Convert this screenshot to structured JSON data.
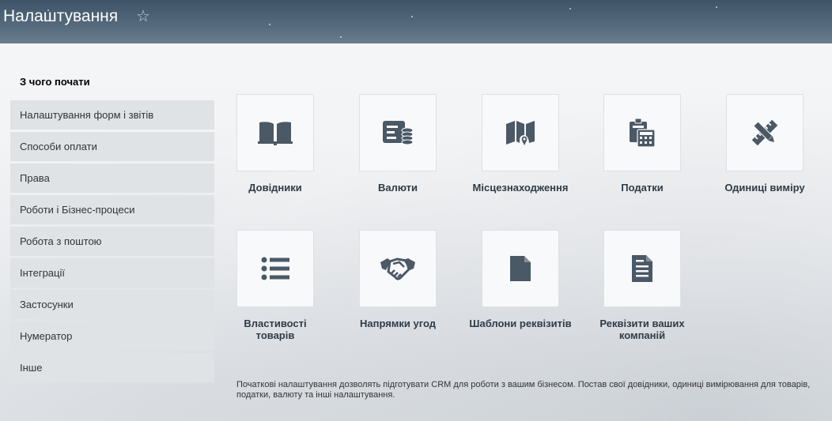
{
  "header": {
    "title": "Налаштування"
  },
  "sidebar": {
    "title": "З чого почати",
    "items": [
      {
        "label": "Налаштування форм і звітів"
      },
      {
        "label": "Способи оплати"
      },
      {
        "label": "Права"
      },
      {
        "label": "Роботи і Бізнес-процеси"
      },
      {
        "label": "Робота з поштою"
      },
      {
        "label": "Інтеграції"
      },
      {
        "label": "Застосунки"
      },
      {
        "label": "Нумератор"
      },
      {
        "label": "Інше"
      }
    ]
  },
  "tiles": [
    {
      "label": "Довідники",
      "icon": "book-icon"
    },
    {
      "label": "Валюти",
      "icon": "currency-icon"
    },
    {
      "label": "Місцезнаходження",
      "icon": "map-icon"
    },
    {
      "label": "Податки",
      "icon": "calculator-icon"
    },
    {
      "label": "Одиниці виміру",
      "icon": "ruler-pencil-icon"
    },
    {
      "label": "Властивості товарів",
      "icon": "list-icon"
    },
    {
      "label": "Напрямки угод",
      "icon": "handshake-icon"
    },
    {
      "label": "Шаблони реквізитів",
      "icon": "document-blank-icon"
    },
    {
      "label": "Реквізити ваших компаній",
      "icon": "document-text-icon"
    }
  ],
  "footer": {
    "text": "Початкові налаштування дозволять підготувати CRM для роботи з вашим бізнесом. Постав свої довідники, одиниці вимірювання для товарів, податки, валюту та інші налаштування."
  },
  "colors": {
    "icon": "#4b5866",
    "header": "#4a5e72",
    "sidebar_item": "#dfe3e6"
  }
}
